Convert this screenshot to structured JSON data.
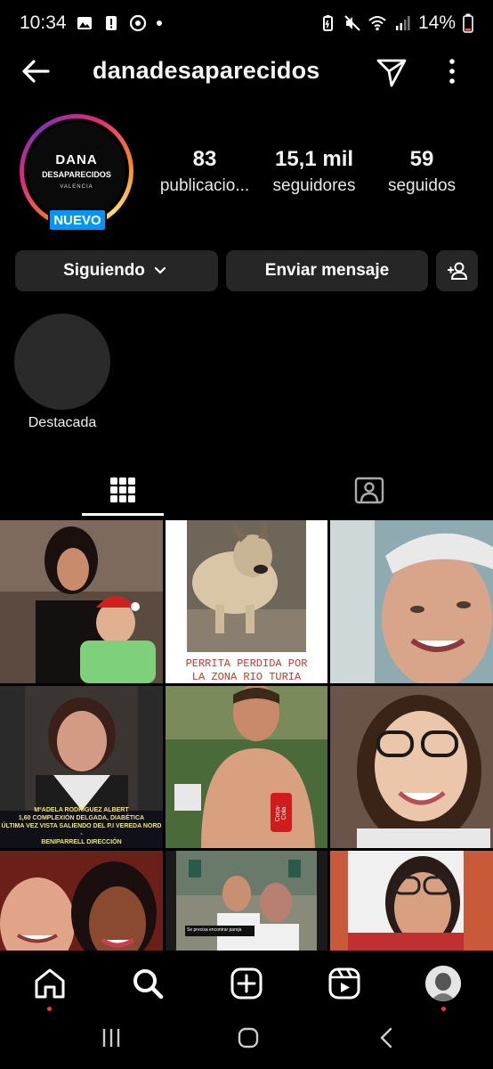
{
  "status": {
    "time": "10:34",
    "battery": "14%"
  },
  "header": {
    "username": "danadesaparecidos"
  },
  "profile": {
    "logo_line1": "DANA",
    "logo_line2": "DESAPARECIDOS",
    "logo_line3": "VALENCIA",
    "badge": "NUEVO",
    "stats": [
      {
        "value": "83",
        "label": "publicacio..."
      },
      {
        "value": "15,1 mil",
        "label": "seguidores"
      },
      {
        "value": "59",
        "label": "seguidos"
      }
    ]
  },
  "actions": {
    "following": "Siguiendo",
    "message": "Enviar mensaje"
  },
  "highlights": [
    {
      "label": "Destacada"
    }
  ],
  "posts": {
    "captions": {
      "dog_line1": "PERRITA PERDIDA POR",
      "dog_line2": "LA ZONA RIO TURIA",
      "poster_line1": "MªADELA RODRÍGUEZ ALBERT",
      "poster_line2": "1,60 COMPLEXIÓN DELGADA, DIABÉTICA",
      "poster_line3": "ÚLTIMA VEZ VISTA SALIENDO DEL P.I VEREDA NORD -",
      "poster_line4": "BENIPARRELL DIRECCIÓN",
      "can_text": "Coca-Cola",
      "banner_text": "Se precisa encontrar pareja"
    }
  },
  "icons": {
    "back": "arrow-left-icon",
    "send": "paper-plane-icon",
    "more": "more-vertical-icon",
    "add_user": "add-user-icon",
    "grid": "grid-icon",
    "tagged": "tagged-icon",
    "home": "home-icon",
    "search": "search-icon",
    "create": "plus-square-icon",
    "reels": "reels-icon"
  },
  "colors": {
    "background": "#000000",
    "button": "#262626",
    "badge": "#0095f6",
    "notification_dot": "#ff3040"
  }
}
